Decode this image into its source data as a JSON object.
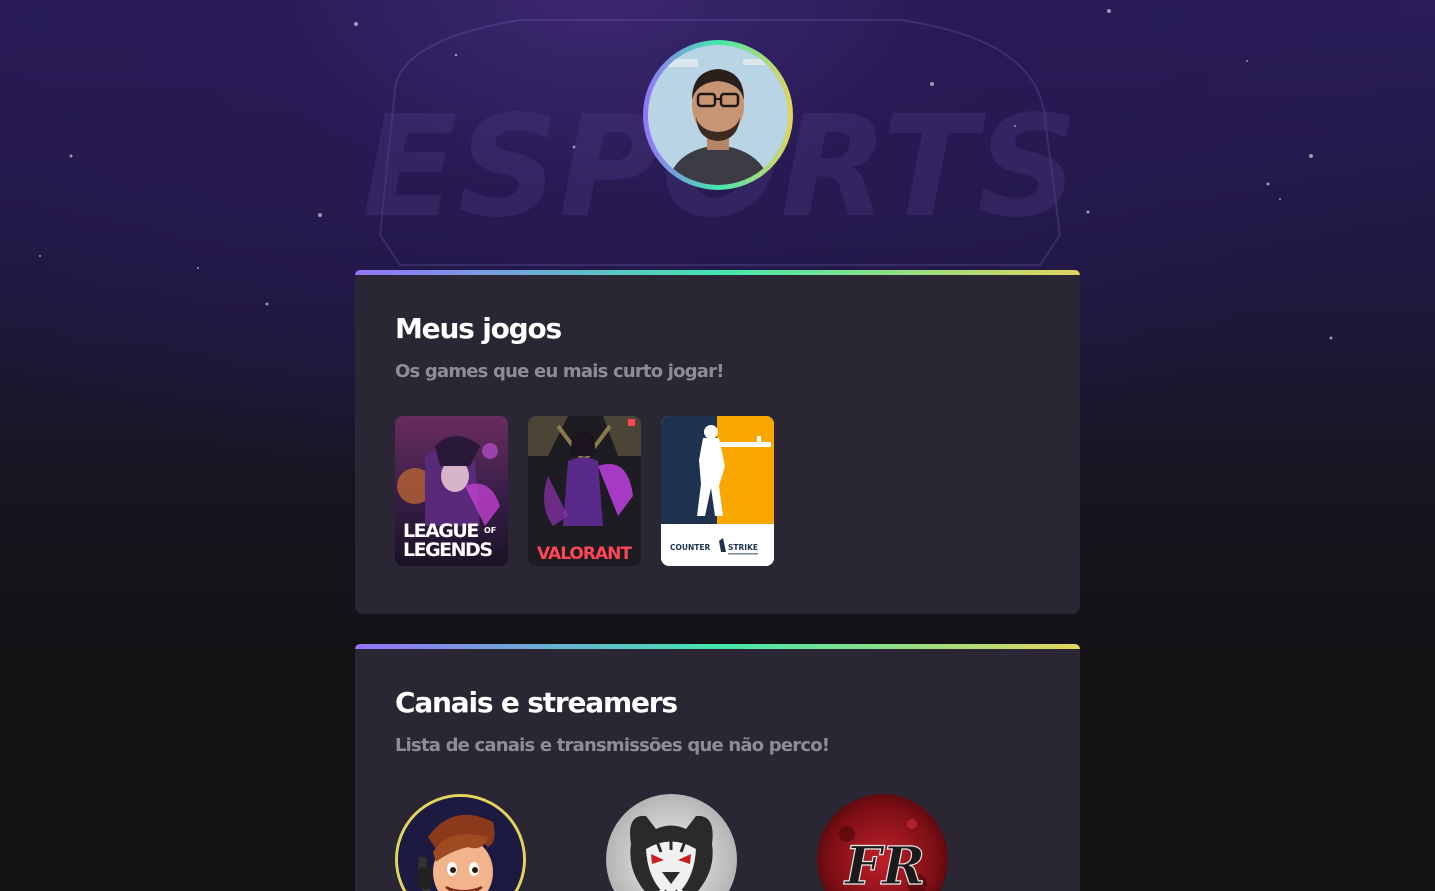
{
  "profile": {
    "avatar_icon": "user-avatar-photo"
  },
  "background": {
    "logo_text": "ESPORTS"
  },
  "games_section": {
    "title": "Meus jogos",
    "subtitle": "Os games que eu mais curto jogar!",
    "games": [
      {
        "name": "LEAGUE OF LEGENDS",
        "line1": "LEAGUE",
        "of": "OF",
        "line2": "LEGENDS"
      },
      {
        "name": "VALORANT",
        "label": "VALORANT"
      },
      {
        "name": "COUNTER STRIKE",
        "word1": "COUNTER",
        "word2": "STRIKE"
      }
    ]
  },
  "streamers_section": {
    "title": "Canais e streamers",
    "subtitle": "Lista de canais e transmissões que não perco!",
    "streamers": [
      {
        "icon": "cartoon-gamer-avatar"
      },
      {
        "icon": "tiger-avatar"
      },
      {
        "icon": "fr-logo-avatar",
        "logo_text": "FR"
      }
    ]
  },
  "colors": {
    "gradient_start": "#9572fc",
    "gradient_mid": "#43e7ad",
    "gradient_end": "#e2d45c",
    "card_bg": "#2a2634",
    "subtitle": "#8d8d99"
  }
}
